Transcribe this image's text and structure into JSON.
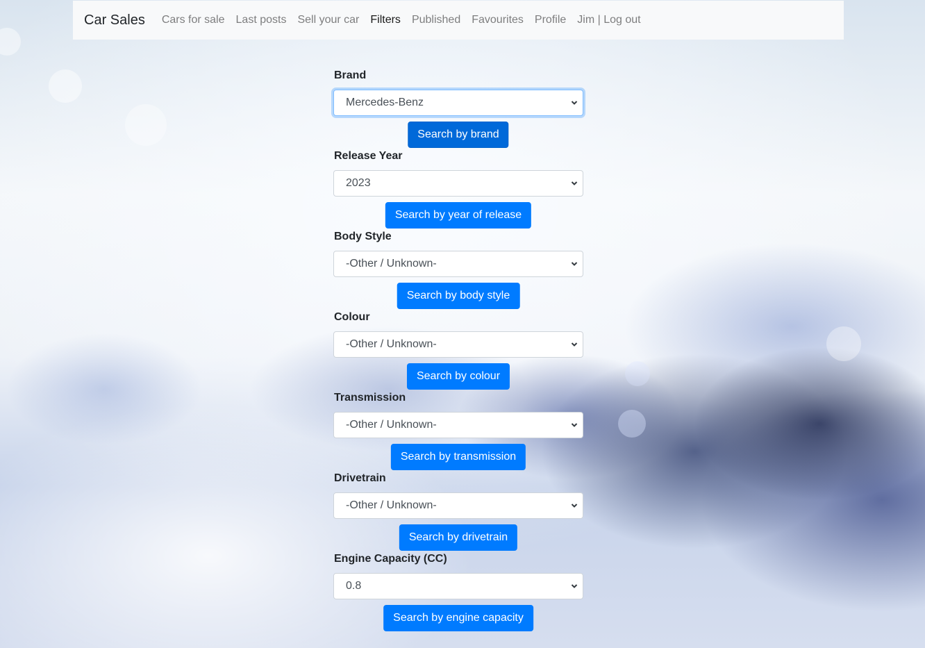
{
  "nav": {
    "brand": "Car Sales",
    "links": [
      {
        "label": "Cars for sale",
        "active": false
      },
      {
        "label": "Last posts",
        "active": false
      },
      {
        "label": "Sell your car",
        "active": false
      },
      {
        "label": "Filters",
        "active": true
      },
      {
        "label": "Published",
        "active": false
      },
      {
        "label": "Favourites",
        "active": false
      },
      {
        "label": "Profile",
        "active": false
      },
      {
        "label": "Jim | Log out",
        "active": false
      }
    ]
  },
  "filters": [
    {
      "label": "Brand",
      "selected": "Mercedes-Benz",
      "button": "Search by brand"
    },
    {
      "label": "Release Year",
      "selected": "2023",
      "button": "Search by year of release"
    },
    {
      "label": "Body Style",
      "selected": "-Other / Unknown-",
      "button": "Search by body style"
    },
    {
      "label": "Colour",
      "selected": "-Other / Unknown-",
      "button": "Search by colour"
    },
    {
      "label": "Transmission",
      "selected": "-Other / Unknown-",
      "button": "Search by transmission"
    },
    {
      "label": "Drivetrain",
      "selected": "-Other / Unknown-",
      "button": "Search by drivetrain"
    },
    {
      "label": "Engine Capacity (CC)",
      "selected": "0.8",
      "button": "Search by engine capacity"
    }
  ],
  "colors": {
    "primary": "#007bff",
    "navbar_bg": "#f8f9fa"
  },
  "icons": {
    "select_arrow": "chevron-down-icon"
  }
}
